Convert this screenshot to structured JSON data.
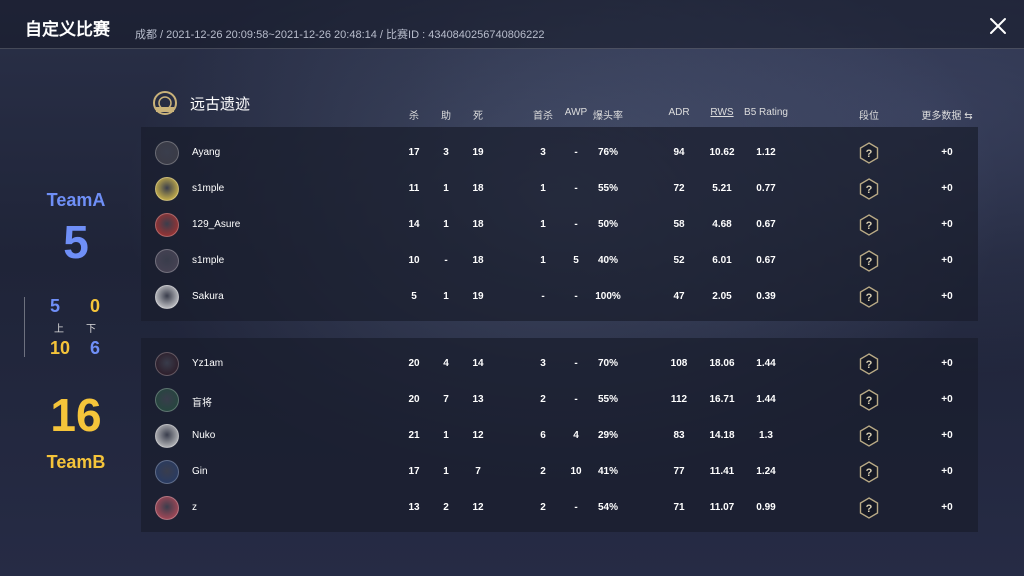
{
  "header": {
    "title": "自定义比赛",
    "meta": "成都 / 2021-12-26 20:09:58~2021-12-26 20:48:14 / 比赛ID : 4340840256740806222"
  },
  "score": {
    "team_a": "TeamA",
    "team_a_total": "5",
    "team_b": "TeamB",
    "team_b_total": "16",
    "half_top_a": "5",
    "half_top_b": "0",
    "label_first": "上",
    "label_second": "下",
    "half_bottom_a": "10",
    "half_bottom_b": "6"
  },
  "map": {
    "name": "远古遗迹",
    "icon": "map-emblem-icon"
  },
  "columns": {
    "kills": "杀",
    "assists": "助",
    "deaths": "死",
    "first_kill": "首杀",
    "awp": "AWP",
    "headshot": "爆头率",
    "adr": "ADR",
    "rws": "RWS",
    "rating": "B5 Rating",
    "rank": "段位",
    "more": "更多数据 ⇆"
  },
  "colors": {
    "team_a": "#6f8ff7",
    "team_b": "#f5c43a"
  },
  "team_a_players": [
    {
      "name": "Ayang",
      "kills": "17",
      "assists": "3",
      "deaths": "19",
      "first_kill": "3",
      "awp": "-",
      "hs": "76%",
      "adr": "94",
      "rws": "10.62",
      "rating": "1.12",
      "delta": "+0"
    },
    {
      "name": "s1mple",
      "kills": "11",
      "assists": "1",
      "deaths": "18",
      "first_kill": "1",
      "awp": "-",
      "hs": "55%",
      "adr": "72",
      "rws": "5.21",
      "rating": "0.77",
      "delta": "+0"
    },
    {
      "name": "129_Asure",
      "kills": "14",
      "assists": "1",
      "deaths": "18",
      "first_kill": "1",
      "awp": "-",
      "hs": "50%",
      "adr": "58",
      "rws": "4.68",
      "rating": "0.67",
      "delta": "+0"
    },
    {
      "name": "s1mple",
      "kills": "10",
      "assists": "-",
      "deaths": "18",
      "first_kill": "1",
      "awp": "5",
      "hs": "40%",
      "adr": "52",
      "rws": "6.01",
      "rating": "0.67",
      "delta": "+0"
    },
    {
      "name": "Sakura",
      "kills": "5",
      "assists": "1",
      "deaths": "19",
      "first_kill": "-",
      "awp": "-",
      "hs": "100%",
      "adr": "47",
      "rws": "2.05",
      "rating": "0.39",
      "delta": "+0"
    }
  ],
  "team_b_players": [
    {
      "name": "Yz1am",
      "kills": "20",
      "assists": "4",
      "deaths": "14",
      "first_kill": "3",
      "awp": "-",
      "hs": "70%",
      "adr": "108",
      "rws": "18.06",
      "rating": "1.44",
      "delta": "+0"
    },
    {
      "name": "盲将",
      "kills": "20",
      "assists": "7",
      "deaths": "13",
      "first_kill": "2",
      "awp": "-",
      "hs": "55%",
      "adr": "112",
      "rws": "16.71",
      "rating": "1.44",
      "delta": "+0"
    },
    {
      "name": "Nuko",
      "kills": "21",
      "assists": "1",
      "deaths": "12",
      "first_kill": "6",
      "awp": "4",
      "hs": "29%",
      "adr": "83",
      "rws": "14.18",
      "rating": "1.3",
      "delta": "+0"
    },
    {
      "name": "Gin",
      "kills": "17",
      "assists": "1",
      "deaths": "7",
      "first_kill": "2",
      "awp": "10",
      "hs": "41%",
      "adr": "77",
      "rws": "11.41",
      "rating": "1.24",
      "delta": "+0"
    },
    {
      "name": "z",
      "kills": "13",
      "assists": "2",
      "deaths": "12",
      "first_kill": "2",
      "awp": "-",
      "hs": "54%",
      "adr": "71",
      "rws": "11.07",
      "rating": "0.99",
      "delta": "+0"
    }
  ]
}
